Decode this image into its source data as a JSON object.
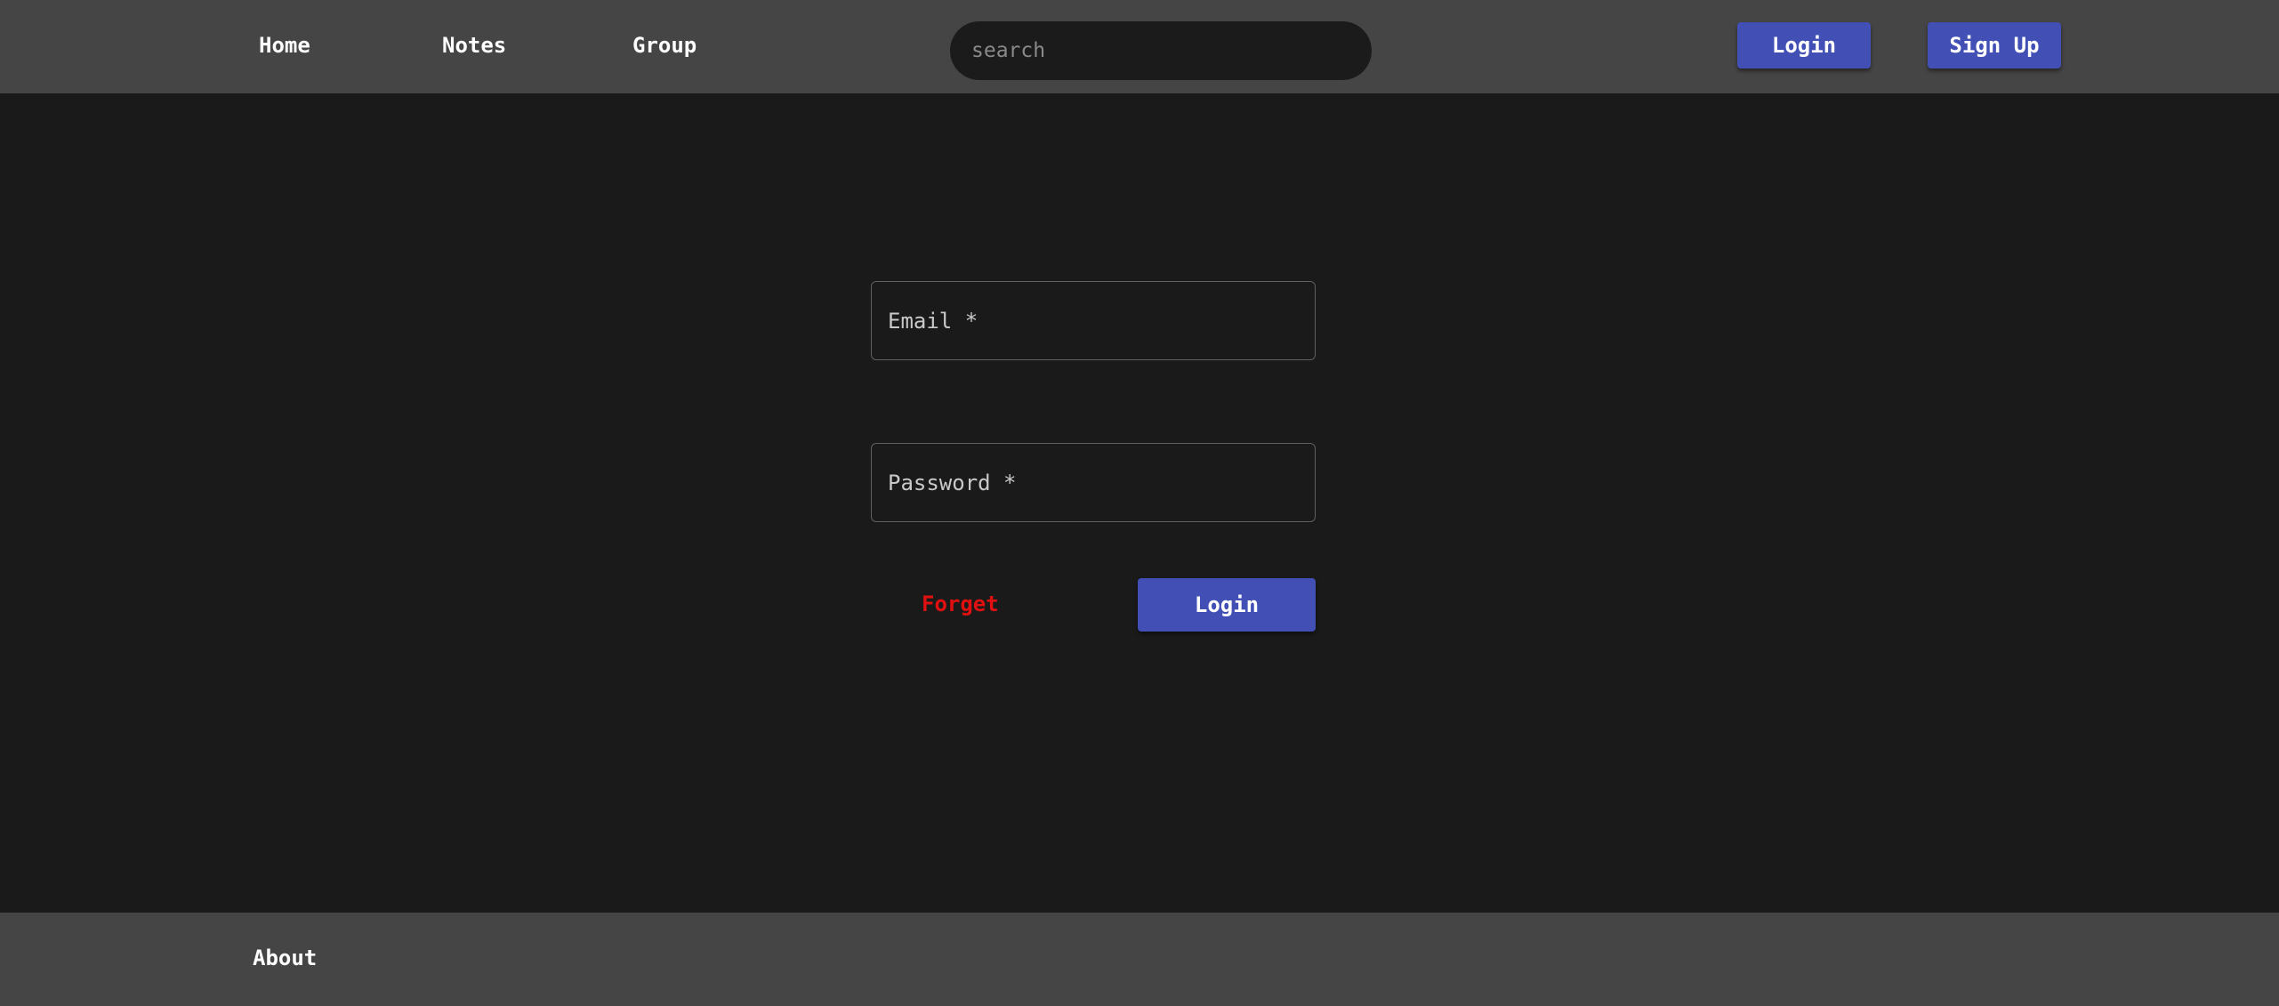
{
  "header": {
    "nav": {
      "home": "Home",
      "notes": "Notes",
      "group": "Group"
    },
    "search": {
      "placeholder": "search",
      "value": ""
    },
    "login_label": "Login",
    "signup_label": "Sign Up"
  },
  "form": {
    "email_label": "Email *",
    "password_label": "Password *",
    "forget_label": "Forget",
    "login_label": "Login"
  },
  "footer": {
    "about_label": "About"
  },
  "colors": {
    "header_bg": "#454545",
    "page_bg": "#1a1a1a",
    "accent": "#4250b5",
    "forget_text": "#e01010",
    "search_bg": "#1b1b1b"
  }
}
